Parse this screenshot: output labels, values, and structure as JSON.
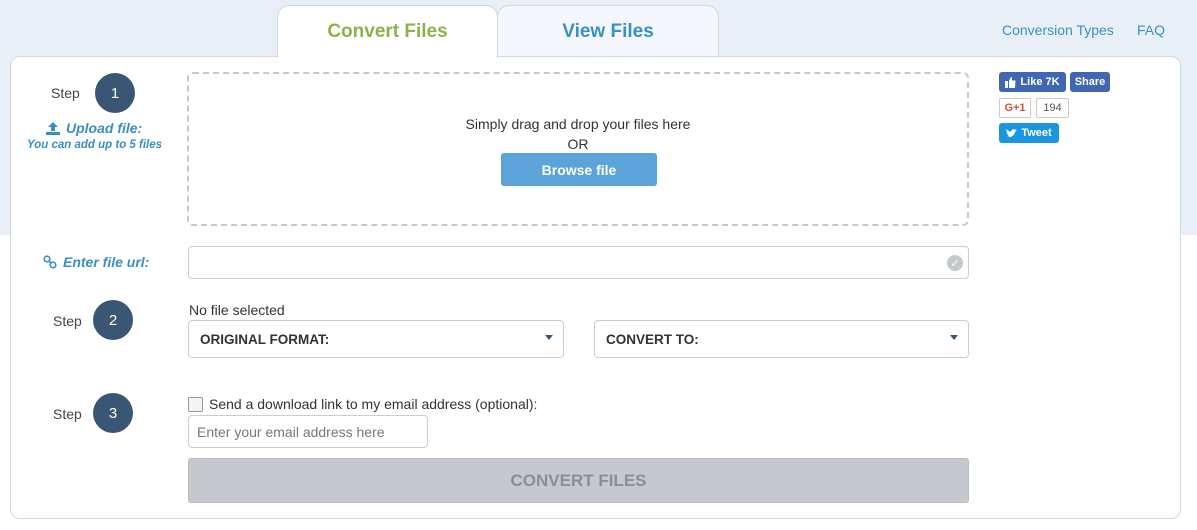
{
  "tabs": [
    {
      "label": "Convert Files",
      "active": true
    },
    {
      "label": "View Files",
      "active": false
    }
  ],
  "top_links": {
    "conversion_types": "Conversion Types",
    "faq": "FAQ"
  },
  "steps": [
    {
      "label": "Step",
      "number": "1"
    },
    {
      "label": "Step",
      "number": "2"
    },
    {
      "label": "Step",
      "number": "3"
    }
  ],
  "upload": {
    "label": "Upload file:",
    "note": "You can add up to 5 files",
    "icon": "upload-icon"
  },
  "dropzone": {
    "text": "Simply drag and drop your files here",
    "or": "OR",
    "browse_label": "Browse file"
  },
  "social": {
    "fb_like": "Like 7K",
    "fb_share": "Share",
    "gplus": "G+1",
    "gplus_count": "194",
    "tweet": "Tweet"
  },
  "url": {
    "label": "Enter file url:",
    "value": "",
    "icon": "link-icon"
  },
  "format": {
    "status": "No file selected",
    "original": "ORIGINAL FORMAT:",
    "convert_to": "CONVERT TO:"
  },
  "email": {
    "checkbox_label": "Send a download link to my email address (optional):",
    "checked": false,
    "placeholder": "Enter your email address here",
    "value": ""
  },
  "convert_button": "CONVERT FILES",
  "colors": {
    "background_band": "#e9eff7",
    "accent_green": "#8fb04a",
    "accent_blue": "#3a8fc4",
    "step_circle": "#3a5674",
    "browse_button": "#5ba3d9",
    "disabled_button": "#c5c9ce"
  }
}
